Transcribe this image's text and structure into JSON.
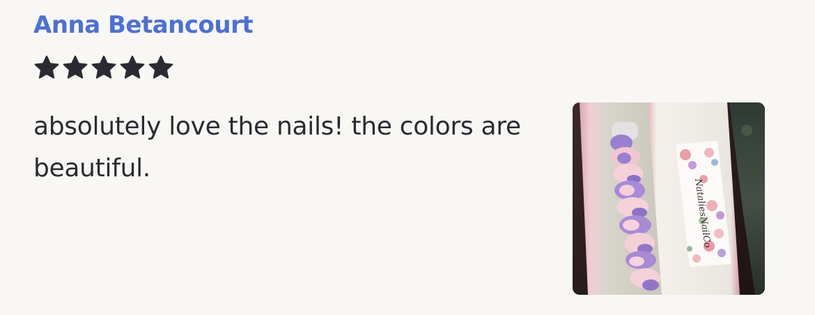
{
  "review": {
    "reviewer_name": "Anna Betancourt",
    "rating": 5,
    "max_rating": 5,
    "text": "absolutely love the nails! the colors are beautiful.",
    "photo": {
      "alt": "",
      "brand_label": "NataliesNailCo"
    }
  },
  "colors": {
    "name": "#4b71d6",
    "star": "#2b2a33",
    "text": "#2b2a33",
    "background": "#f8f7f4"
  }
}
